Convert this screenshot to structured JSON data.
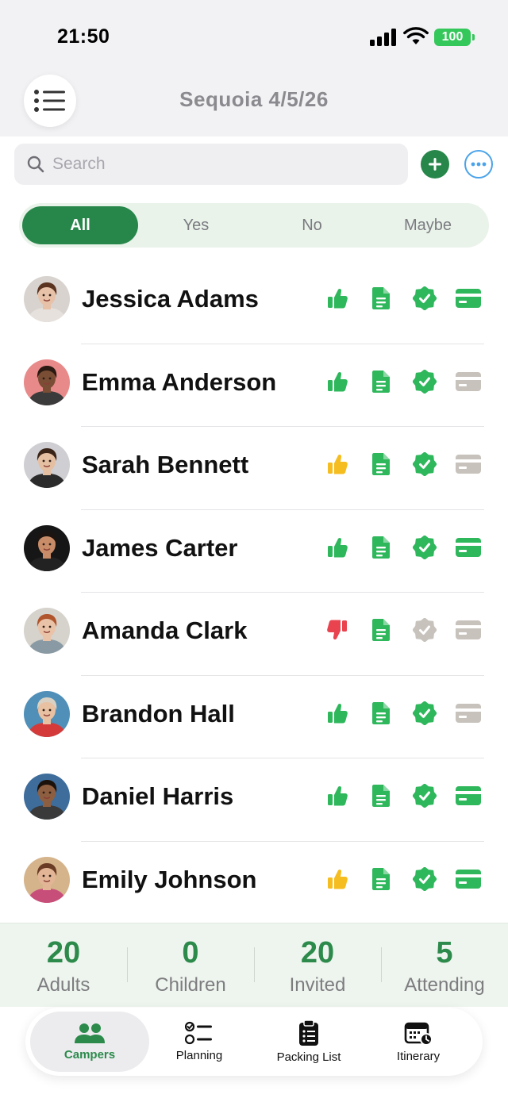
{
  "status_bar": {
    "time": "21:50",
    "battery": "100"
  },
  "header": {
    "title": "Sequoia 4/5/26",
    "menu_icon": "list-icon"
  },
  "search": {
    "placeholder": "Search",
    "value": ""
  },
  "actions": {
    "add_icon": "plus-icon",
    "more_icon": "ellipsis-icon"
  },
  "filter": {
    "selected": "All",
    "segments": [
      {
        "label": "All"
      },
      {
        "label": "Yes"
      },
      {
        "label": "No"
      },
      {
        "label": "Maybe"
      }
    ]
  },
  "colors": {
    "accent": "#27874a",
    "green": "#2fb75c",
    "yellow": "#f5bd1f",
    "red": "#e8434f",
    "gray": "#c7c2bc",
    "link": "#4aa3ea"
  },
  "campers": [
    {
      "name": "Jessica Adams",
      "rsvp": "yes",
      "document": "complete",
      "verified": true,
      "paid": true,
      "avatar": {
        "skin": "#e7c1a8",
        "hair": "#5a3321",
        "shirt": "#e6e1dc",
        "bg": "#d8d3cf"
      }
    },
    {
      "name": "Emma Anderson",
      "rsvp": "yes",
      "document": "complete",
      "verified": true,
      "paid": false,
      "avatar": {
        "skin": "#7a4d35",
        "hair": "#2a1a12",
        "shirt": "#3b3b3b",
        "bg": "#e88a8a"
      }
    },
    {
      "name": "Sarah Bennett",
      "rsvp": "maybe",
      "document": "complete",
      "verified": true,
      "paid": false,
      "avatar": {
        "skin": "#e5bfa2",
        "hair": "#3a2418",
        "shirt": "#2b2b2b",
        "bg": "#cfcfd3"
      }
    },
    {
      "name": "James Carter",
      "rsvp": "yes",
      "document": "complete",
      "verified": true,
      "paid": true,
      "avatar": {
        "skin": "#c98c68",
        "hair": "#1c1410",
        "shirt": "#222222",
        "bg": "#161616"
      }
    },
    {
      "name": "Amanda Clark",
      "rsvp": "no",
      "document": "complete",
      "verified": false,
      "paid": false,
      "avatar": {
        "skin": "#e9c3a8",
        "hair": "#b0552c",
        "shirt": "#8a9aa4",
        "bg": "#d6d2cc"
      }
    },
    {
      "name": "Brandon Hall",
      "rsvp": "yes",
      "document": "complete",
      "verified": true,
      "paid": false,
      "avatar": {
        "skin": "#e8c0a2",
        "hair": "#d9d2c4",
        "shirt": "#d43a3a",
        "bg": "#4f8fb8"
      }
    },
    {
      "name": "Daniel Harris",
      "rsvp": "yes",
      "document": "complete",
      "verified": true,
      "paid": true,
      "avatar": {
        "skin": "#8e5e40",
        "hair": "#1c120c",
        "shirt": "#3a3a3a",
        "bg": "#3e6d9c"
      }
    },
    {
      "name": "Emily Johnson",
      "rsvp": "maybe",
      "document": "complete",
      "verified": true,
      "paid": true,
      "avatar": {
        "skin": "#e2b596",
        "hair": "#6a3b24",
        "shirt": "#c84e7a",
        "bg": "#d5b48c"
      }
    }
  ],
  "stats": [
    {
      "value": "20",
      "label": "Adults"
    },
    {
      "value": "0",
      "label": "Children"
    },
    {
      "value": "20",
      "label": "Invited"
    },
    {
      "value": "5",
      "label": "Attending"
    }
  ],
  "tabs": [
    {
      "label": "Campers",
      "icon": "people-icon",
      "active": true
    },
    {
      "label": "Planning",
      "icon": "checklist-icon",
      "active": false
    },
    {
      "label": "Packing List",
      "icon": "clipboard-icon",
      "active": false
    },
    {
      "label": "Itinerary",
      "icon": "calendar-icon",
      "active": false
    }
  ]
}
